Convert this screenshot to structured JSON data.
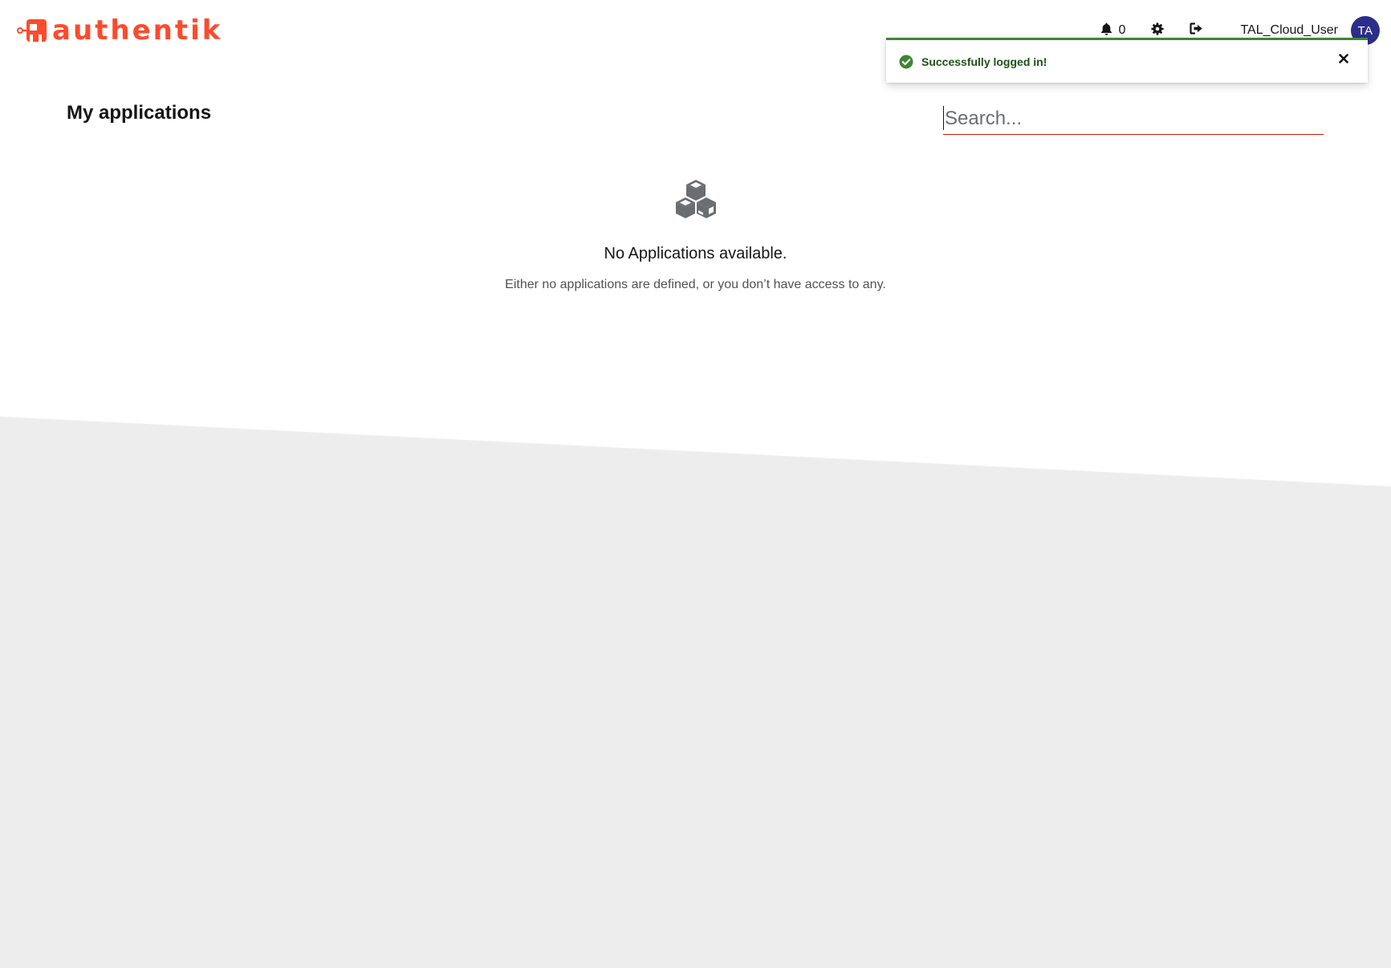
{
  "brand": {
    "name": "authentik",
    "color": "#fd4b2d"
  },
  "header": {
    "notifications_count": "0",
    "username": "TAL_Cloud_User",
    "avatar_initials": "TA",
    "icons": {
      "notifications": "bell-icon",
      "settings": "gear-icon",
      "logout": "sign-out-icon"
    }
  },
  "toast": {
    "message": "Successfully logged in!",
    "status": "success",
    "status_color": "#3e8635",
    "icon": "check-circle-icon",
    "close_icon": "close-icon"
  },
  "main": {
    "title": "My applications",
    "search": {
      "placeholder": "Search...",
      "value": ""
    },
    "empty_state": {
      "icon": "cubes-icon",
      "title": "No Applications available.",
      "body": "Either no applications are defined, or you don’t have access to any."
    }
  },
  "colors": {
    "background_lower": "#ededed",
    "search_underline": "#c9190b",
    "avatar_bg": "#2b2e8a"
  }
}
